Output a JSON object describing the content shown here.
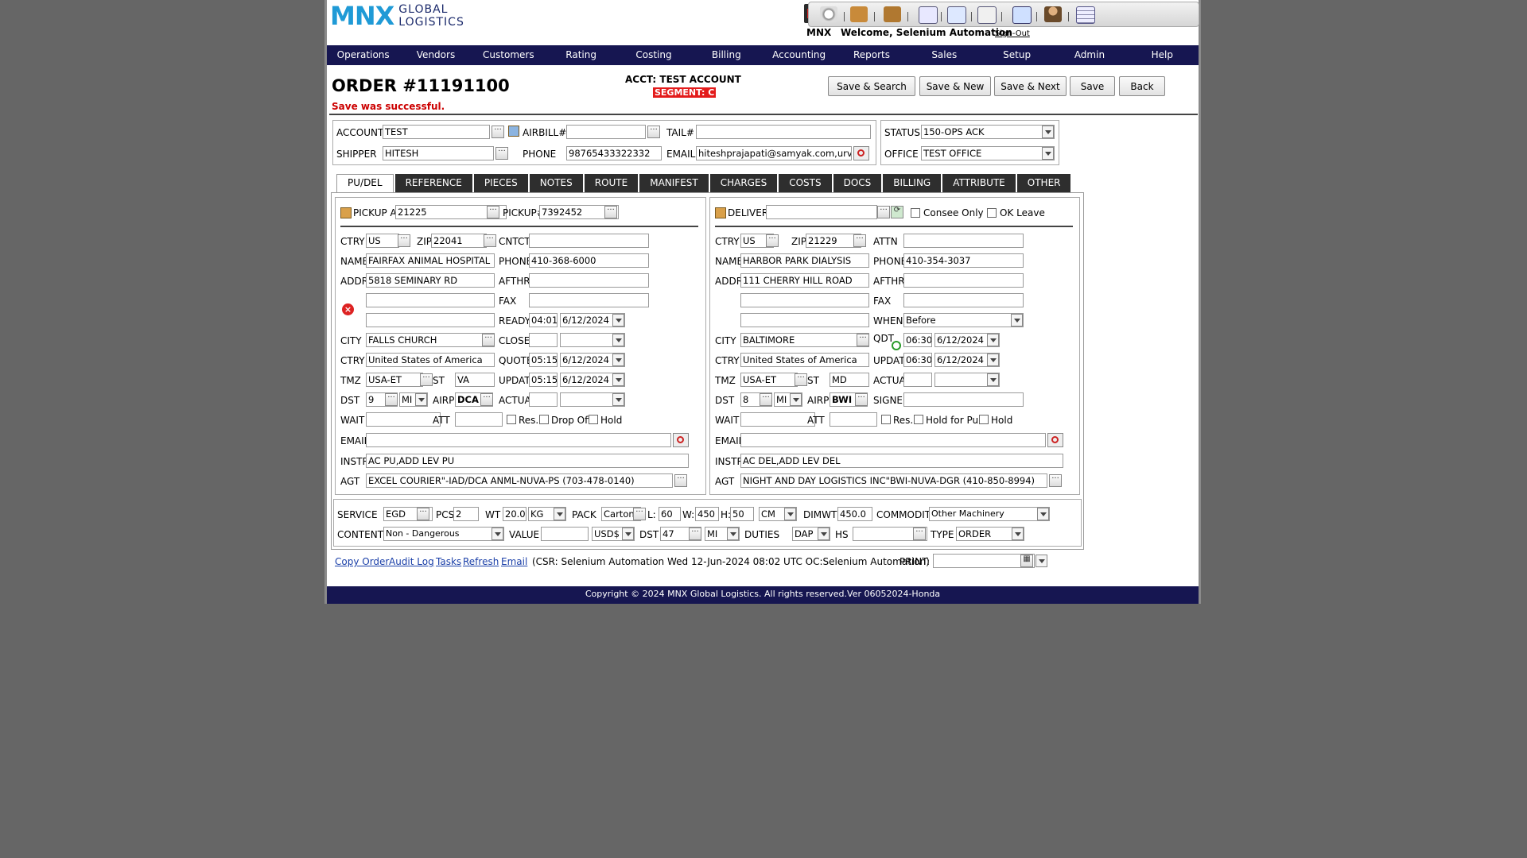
{
  "brand": {
    "mnx": "MNX",
    "global": "GLOBAL",
    "logistics": "LOGISTICS"
  },
  "header": {
    "mnx_label": "MNX",
    "welcome": "Welcome, Selenium Automation",
    "signout": "Sign-Out"
  },
  "nav": [
    "Operations",
    "Vendors",
    "Customers",
    "Rating",
    "Costing",
    "Billing",
    "Accounting",
    "Reports",
    "Sales",
    "Setup",
    "Admin",
    "Help"
  ],
  "order": {
    "title": "ORDER #11191100",
    "save_msg": "Save was successful.",
    "acct": "ACCT: TEST ACCOUNT",
    "segment": "SEGMENT: C"
  },
  "buttons": {
    "save_search": "Save & Search",
    "save_new": "Save & New",
    "save_next": "Save & Next",
    "save": "Save",
    "back": "Back"
  },
  "top": {
    "account_label": "ACCOUNT",
    "account": "TEST",
    "airbill_label": "AIRBILL#",
    "airbill": "",
    "tail_label": "TAIL#",
    "tail": "",
    "shipper_label": "SHIPPER",
    "shipper": "HITESH",
    "phone_label": "PHONE",
    "phone": "98765433322332",
    "email_label": "EMAIL",
    "email": "hiteshprajapati@samyak.com,urvas",
    "status_label": "STATUS",
    "status": "150-OPS ACK",
    "office_label": "OFFICE",
    "office": "TEST OFFICE"
  },
  "tabs": [
    "PU/DEL",
    "REFERENCE",
    "PIECES",
    "NOTES",
    "ROUTE",
    "MANIFEST",
    "CHARGES",
    "COSTS",
    "DOCS",
    "BILLING",
    "ATTRIBUTE",
    "OTHER"
  ],
  "pickup": {
    "pickup_at_label": "PICKUP AT:",
    "pickup_at": "21225",
    "pickup_no_label": "PICKUP#:",
    "pickup_no": "7392452",
    "ctry_label": "CTRY",
    "ctry": "US",
    "zip_label": "ZIP",
    "zip": "22041",
    "cntct_label": "CNTCT",
    "cntct": "",
    "name_label": "NAME",
    "name": "FAIRFAX ANIMAL HOSPITAL",
    "phone_label": "PHONE",
    "phone": "410-368-6000",
    "addr_label": "ADDR",
    "addr": "5818 SEMINARY RD",
    "afthrs_label": "AFTHRS",
    "afthrs": "",
    "fax_label": "FAX",
    "fax": "",
    "ready_label": "READY",
    "ready_time": "04:01",
    "ready_date": "6/12/2024",
    "city_label": "CITY",
    "city": "FALLS CHURCH",
    "close_label": "CLOSE",
    "close_time": "",
    "close_date": "",
    "ctry2_label": "CTRY",
    "ctry2": "United States of America",
    "quote_label": "QUOTE",
    "quote_time": "05:15",
    "quote_date": "6/12/2024",
    "tmz_label": "TMZ",
    "tmz": "USA-ET",
    "st_label": "ST",
    "st": "VA",
    "update_label": "UPDATE",
    "update_time": "05:15",
    "update_date": "6/12/2024",
    "dst_label": "DST",
    "dst": "9",
    "dst_unit": "MI",
    "airp_label": "AIRP",
    "airp": "DCA",
    "actual_label": "ACTUAL",
    "actual_time": "",
    "actual_date": "",
    "wait_label": "WAIT",
    "wait": "",
    "att_label": "ATT",
    "att": "",
    "res_label": "Res.",
    "dropoff_label": "Drop Off",
    "hold_label": "Hold",
    "email_label": "EMAIL",
    "email": "",
    "instr_label": "INSTR",
    "instr": "AC PU,ADD LEV PU",
    "agt_label": "AGT",
    "agt": "EXCEL COURIER\"-IAD/DCA ANML-NUVA-PS (703-478-0140)"
  },
  "deliver": {
    "deliver_label": "DELIVER:",
    "deliver": "",
    "consee_label": "Consee Only",
    "okleave_label": "OK Leave",
    "ctry_label": "CTRY",
    "ctry": "US",
    "zip_label": "ZIP",
    "zip": "21229",
    "attn_label": "ATTN",
    "attn": "",
    "name_label": "NAME",
    "name": "HARBOR PARK DIALYSIS",
    "phone_label": "PHONE",
    "phone": "410-354-3037",
    "addr_label": "ADDR",
    "addr": "111 CHERRY HILL ROAD",
    "afthrs_label": "AFTHRS",
    "afthrs": "",
    "fax_label": "FAX",
    "fax": "",
    "when_label": "WHEN",
    "when": "Before",
    "city_label": "CITY",
    "city": "BALTIMORE",
    "qdt_label": "QDT",
    "qdt_time": "06:30",
    "qdt_date": "6/12/2024",
    "ctry2_label": "CTRY",
    "ctry2": "United States of America",
    "update_label": "UPDATE",
    "update_time": "06:30",
    "update_date": "6/12/2024",
    "tmz_label": "TMZ",
    "tmz": "USA-ET",
    "st_label": "ST",
    "st": "MD",
    "actual_label": "ACTUAL",
    "actual_time": "",
    "actual_date": "",
    "dst_label": "DST",
    "dst": "8",
    "dst_unit": "MI",
    "airp_label": "AIRP",
    "airp": "BWI",
    "signed_label": "SIGNED",
    "signed": "",
    "wait_label": "WAIT",
    "wait": "",
    "att_label": "ATT",
    "att": "",
    "res_label": "Res.",
    "holdpu_label": "Hold for Pu",
    "hold_label": "Hold",
    "email_label": "EMAIL",
    "email": "",
    "instr_label": "INSTR",
    "instr": "AC DEL,ADD LEV DEL",
    "agt_label": "AGT",
    "agt": "NIGHT AND DAY LOGISTICS INC\"BWI-NUVA-DGR (410-850-8994)"
  },
  "service": {
    "service_label": "SERVICE",
    "service": "EGD",
    "pcs_label": "PCS",
    "pcs": "2",
    "wt_label": "WT",
    "wt": "20.0",
    "wt_unit": "KG",
    "pack_label": "PACK",
    "pack": "Carton I",
    "l_label": "L:",
    "l": "60",
    "w_label": "W:",
    "w": "450",
    "h_label": "H:",
    "h": "50",
    "dim_unit": "CM",
    "dimwt_label": "DIMWT",
    "dimwt": "450.0",
    "commodity_label": "COMMODITY",
    "commodity": "Other Machinery",
    "contents_label": "CONTENTS",
    "contents": "Non - Dangerous",
    "value_label": "VALUE",
    "value": "",
    "currency": "USD$",
    "dst_label": "DST",
    "dst": "47",
    "dst_unit": "MI",
    "duties_label": "DUTIES",
    "duties": "DAP",
    "hs_label": "HS",
    "hs": "",
    "type_label": "TYPE",
    "type": "ORDER"
  },
  "bottom": {
    "copy_order": "Copy Order",
    "audit_log": "Audit Log",
    "tasks": "Tasks",
    "refresh": "Refresh",
    "email": "Email",
    "csr": "(CSR: Selenium Automation Wed 12-Jun-2024 08:02 UTC OC:Selenium Automation)",
    "print_label": "PRINT:",
    "print": ""
  },
  "footer": "Copyright © 2024 MNX Global Logistics. All rights reserved.Ver 06052024-Honda"
}
